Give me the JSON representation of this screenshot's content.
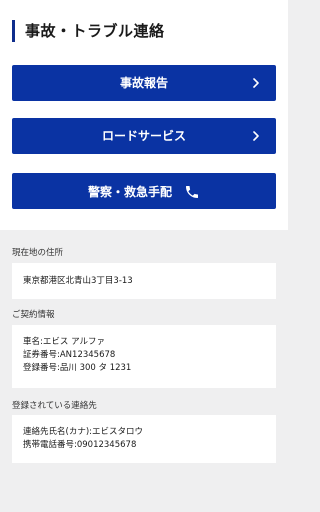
{
  "header": {
    "title": "事故・トラブル連絡"
  },
  "actions": {
    "accident_label": "事故報告",
    "road_service_label": "ロードサービス",
    "police_label": "警察・救急手配"
  },
  "address": {
    "section_label": "現在地の住所",
    "value": "東京都港区北青山3丁目3-13"
  },
  "contract": {
    "section_label": "ご契約情報",
    "car_name": "車名:エビス アルファ",
    "policy_number": "証券番号:AN12345678",
    "registration_number": "登録番号:品川 300 タ 1231"
  },
  "contact": {
    "section_label": "登録されている連絡先",
    "name": "連絡先氏名(カナ):エビスタロウ",
    "phone": "携帯電話番号:09012345678"
  },
  "colors": {
    "accent": "#0a33a3",
    "header_bar": "#0f2d8c",
    "background": "#efeff0"
  },
  "icons": {
    "chevron": "chevron-right-icon",
    "phone": "phone-icon"
  }
}
